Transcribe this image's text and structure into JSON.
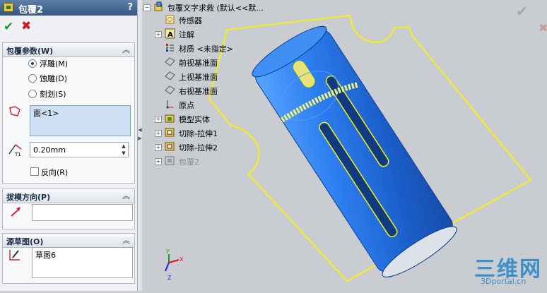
{
  "property_manager": {
    "title": "包覆2",
    "help": "?",
    "ok": "✔",
    "cancel": "✖",
    "params": {
      "header": "包覆参数(W)",
      "options": [
        {
          "label": "浮雕(M)",
          "selected": true
        },
        {
          "label": "蚀雕(D)",
          "selected": false
        },
        {
          "label": "刻划(S)",
          "selected": false
        }
      ],
      "face_selection": "面<1>",
      "thickness": "0.20mm",
      "reverse_label": "反向(R)"
    },
    "draft": {
      "header": "拔模方向(P)",
      "value": ""
    },
    "source_sketch": {
      "header": "源草图(O)",
      "value": "草图6"
    }
  },
  "tree": {
    "root": "包覆文字求救 (默认<<默...",
    "items": [
      {
        "label": "传感器",
        "icon": "sensor-icon",
        "expand": ""
      },
      {
        "label": "注解",
        "icon": "annotation-icon",
        "expand": "+"
      },
      {
        "label": "材质 <未指定>",
        "icon": "material-icon",
        "expand": ""
      },
      {
        "label": "前视基准面",
        "icon": "plane-icon",
        "expand": ""
      },
      {
        "label": "上视基准面",
        "icon": "plane-icon",
        "expand": ""
      },
      {
        "label": "右视基准面",
        "icon": "plane-icon",
        "expand": ""
      },
      {
        "label": "原点",
        "icon": "origin-icon",
        "expand": ""
      },
      {
        "label": "模型实体",
        "icon": "solid-body-icon",
        "expand": "+"
      },
      {
        "label": "切除-拉伸1",
        "icon": "cut-extrude-icon",
        "expand": "+"
      },
      {
        "label": "切除-拉伸2",
        "icon": "cut-extrude-icon",
        "expand": "+"
      },
      {
        "label": "包覆2",
        "icon": "wrap-icon",
        "expand": "+",
        "grayed": true
      }
    ]
  },
  "watermark": {
    "cn": "三维网",
    "en": "3Dportal.cn"
  },
  "colors": {
    "title_bar": "#34577f",
    "model": "#2f7fe0",
    "sketch": "#f5ef14"
  }
}
